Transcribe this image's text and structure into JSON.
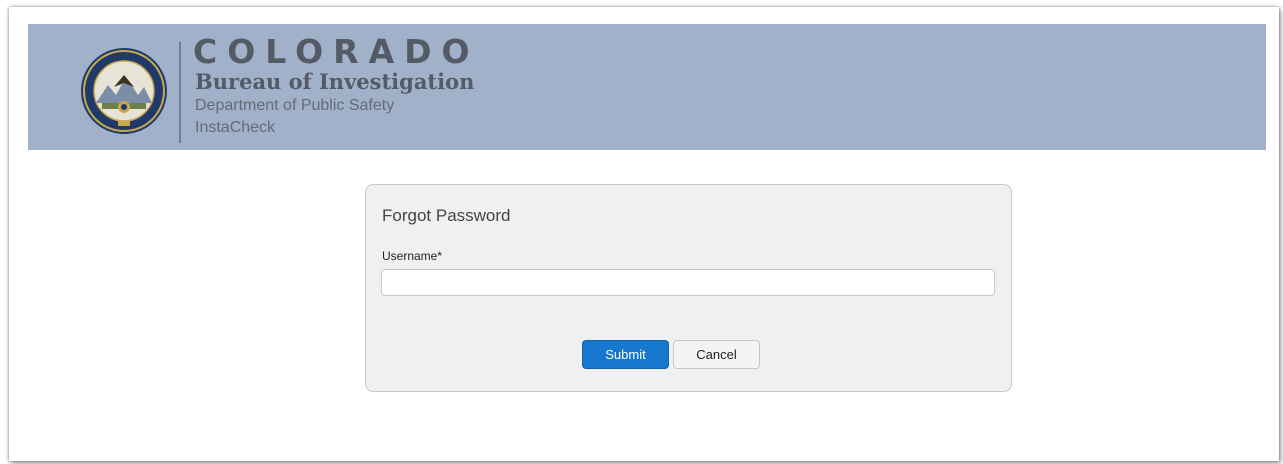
{
  "header": {
    "brand_line1": "COLORADO",
    "brand_line2": "Bureau of Investigation",
    "brand_line3": "Department of Public Safety",
    "app_name": "InstaCheck",
    "background_color": "#a1b1c9",
    "seal_icon": "cbi-seal-icon"
  },
  "form": {
    "title": "Forgot Password",
    "username_label": "Username*",
    "username_value": "",
    "username_placeholder": "",
    "submit_label": "Submit",
    "cancel_label": "Cancel",
    "submit_color": "#1677cf"
  }
}
